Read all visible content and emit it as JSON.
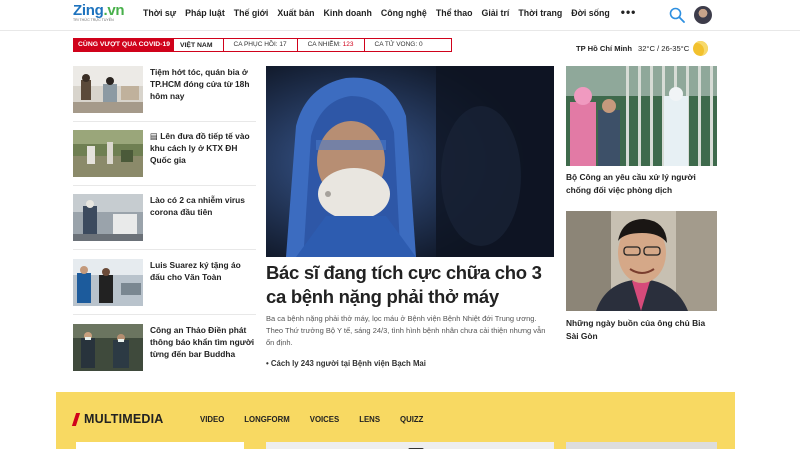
{
  "logo": {
    "z": "Zing",
    "dot": ".vn",
    "tagline": "TRI THỨC TRỰC TUYẾN"
  },
  "nav": [
    "Thời sự",
    "Pháp luật",
    "Thế giới",
    "Xuất bản",
    "Kinh doanh",
    "Công nghệ",
    "Thể thao",
    "Giải trí",
    "Thời trang",
    "Đời sống"
  ],
  "nav_more": "•••",
  "covid": {
    "tag": "CÙNG VƯỢT QUA COVID-19",
    "country": "VIỆT NAM",
    "recovered_label": "CA PHỤC HỒI:",
    "recovered": "17",
    "infected_label": "CA NHIỄM:",
    "infected": "123",
    "deaths_label": "CA TỬ VONG:",
    "deaths": "0"
  },
  "weather": {
    "city": "TP Hồ Chí Minh",
    "temp": "32°C / 26-35°C"
  },
  "left_articles": [
    {
      "title": "Tiệm hớt tóc, quán bia ở TP.HCM đóng cửa từ 18h hôm nay"
    },
    {
      "title": "▤ Lên đưa đồ tiếp tế vào khu cách ly ở KTX ĐH Quốc gia"
    },
    {
      "title": "Lào có 2 ca nhiễm virus corona đầu tiên"
    },
    {
      "title": "Luis Suarez ký tặng áo đấu cho Văn Toàn"
    },
    {
      "title": "Công an Thảo Điền phát thông báo khẩn tìm người từng đến bar Buddha"
    }
  ],
  "hero": {
    "title": "Bác sĩ đang tích cực chữa cho 3 ca bệnh nặng phải thở máy",
    "sapo": "Ba ca bệnh nặng phải thở máy, lọc máu ở Bệnh viện Bệnh Nhiệt đới Trung ương. Theo Thứ trưởng Bộ Y tế, sáng 24/3, tình hình bệnh nhân chưa cải thiện nhưng vẫn ổn định.",
    "related": "• Cách ly 243 người tại Bệnh viện Bạch Mai"
  },
  "right_articles": [
    {
      "title": "Bộ Công an yêu cầu xử lý người chống đối việc phòng dịch"
    },
    {
      "title": "Những ngày buồn của ông chủ Bia Sài Gòn"
    }
  ],
  "multimedia": {
    "title": "MULTIMEDIA",
    "tabs": [
      "VIDEO",
      "LONGFORM",
      "VOICES",
      "LENS",
      "QUIZZ"
    ]
  },
  "colors": {
    "accent_red": "#d0021b",
    "brand_blue": "#1e73be",
    "multimedia_bg": "#f8d962"
  }
}
